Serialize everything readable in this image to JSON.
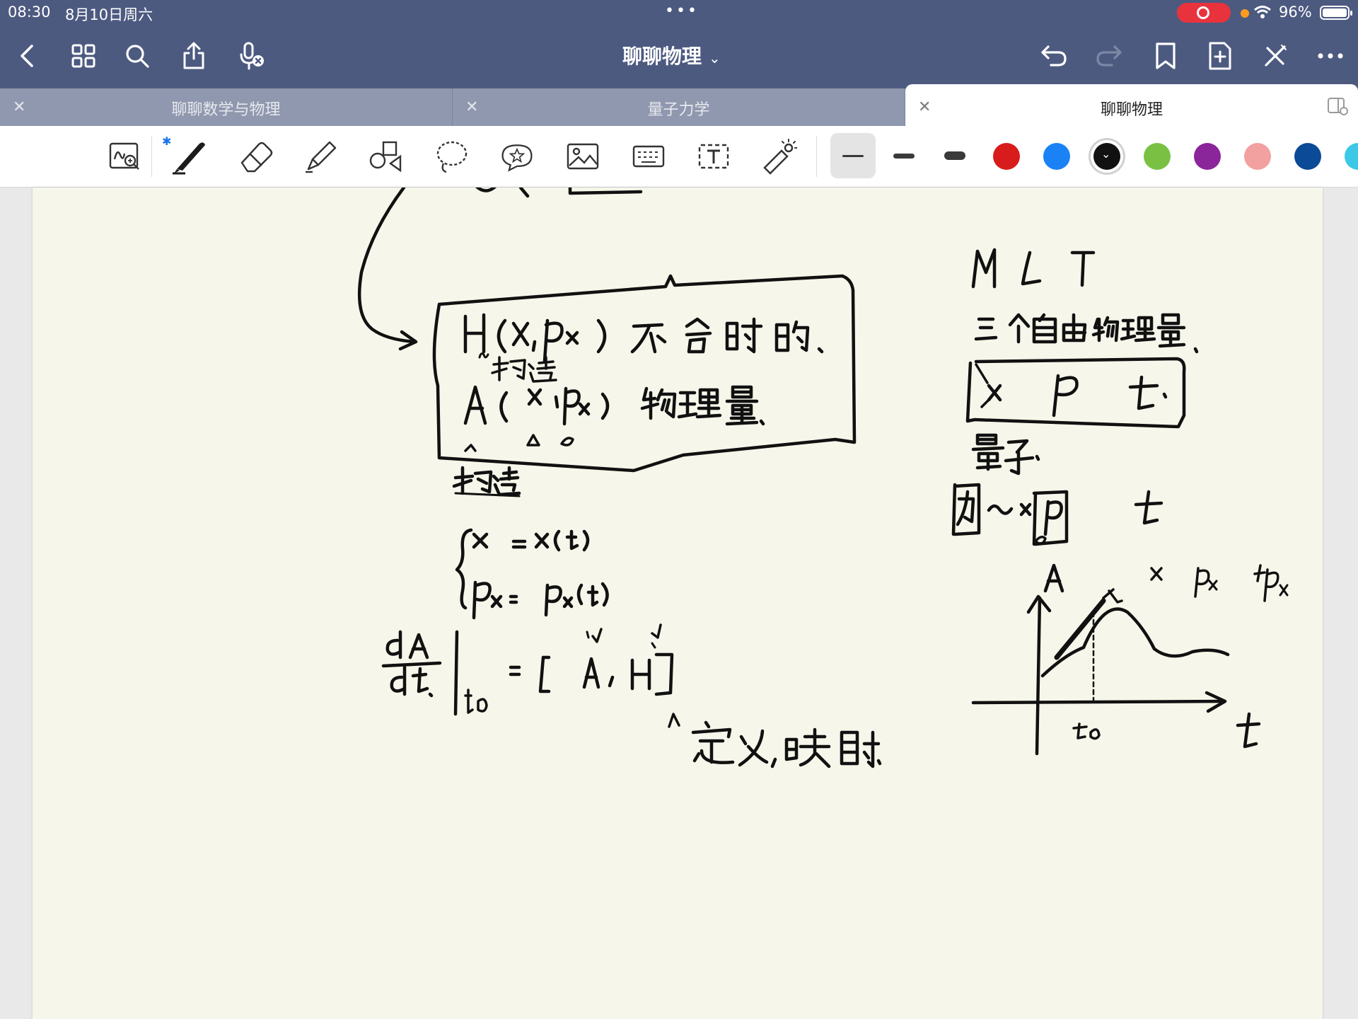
{
  "status_bar": {
    "time": "08:30",
    "date": "8月10日周六",
    "battery": "96%",
    "recording_color": "#e8333d"
  },
  "nav": {
    "title": "聊聊物理",
    "icons": [
      "back-icon",
      "grid-icon",
      "search-icon",
      "share-icon",
      "mic-off-icon",
      "undo-icon",
      "redo-icon",
      "bookmark-icon",
      "add-page-icon",
      "close-pen-icon",
      "more-icon"
    ]
  },
  "tabs": [
    {
      "label": "聊聊数学与物理",
      "active": false
    },
    {
      "label": "量子力学",
      "active": false
    },
    {
      "label": "聊聊物理",
      "active": true
    }
  ],
  "toolbar": {
    "tools": [
      "zoom-lasso-icon",
      "pen-icon",
      "eraser-icon",
      "highlighter-icon",
      "shapes-icon",
      "lasso-icon",
      "sticker-icon",
      "image-icon",
      "keyboard-icon",
      "text-box-icon",
      "laser-pointer-icon"
    ],
    "stroke_widths": [
      "thin",
      "medium",
      "thick"
    ],
    "selected_stroke": "thin",
    "colors": [
      "#d81b1b",
      "#1a82f5",
      "#111111",
      "#7ac143",
      "#8b259a",
      "#f3a0a0",
      "#0b4a96"
    ],
    "selected_color": "#111111"
  },
  "note": {
    "handwriting": [
      "H(x, px) 不含时的",
      "A(x, px) 物理量",
      "构造",
      "构造",
      "x = x(t)",
      "px = px(t)",
      "dA/dt |t0 = [A, H]",
      "定义，映射",
      "M L T",
      "三个自由物理量",
      "x p t",
      "量子",
      "力 ~ x p t",
      "A x px fpx",
      "t0",
      "t"
    ]
  }
}
